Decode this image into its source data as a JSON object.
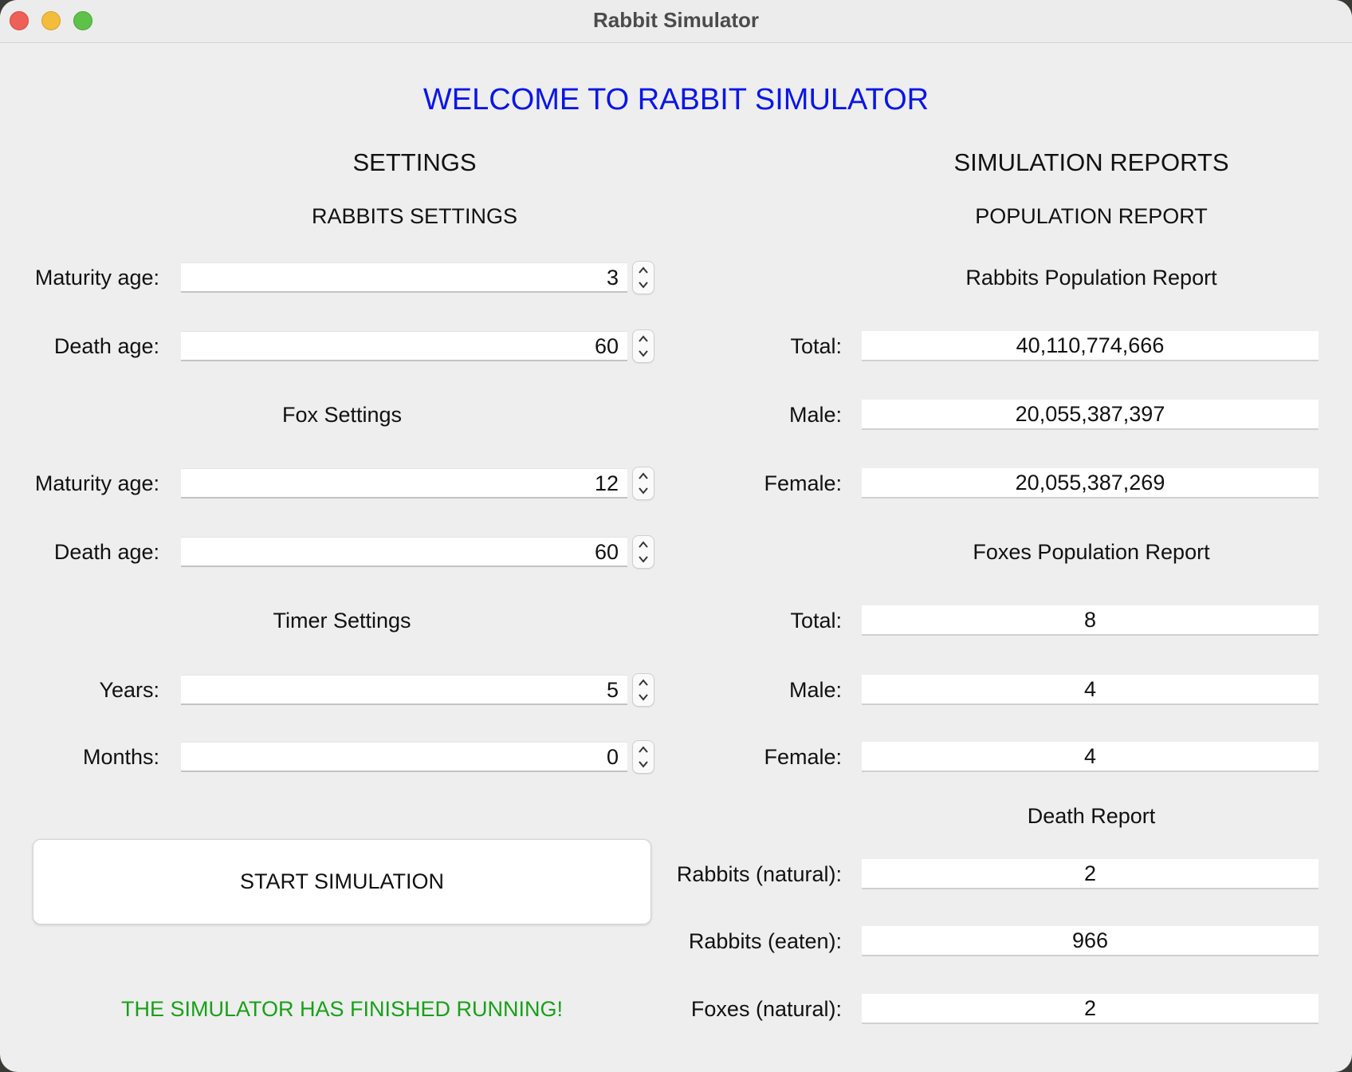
{
  "window": {
    "title": "Rabbit Simulator"
  },
  "welcome": "WELCOME TO RABBIT SIMULATOR",
  "colors": {
    "welcome": "#0a16e6",
    "status": "#18a018"
  },
  "settings": {
    "title": "SETTINGS",
    "rabbits": {
      "title": "RABBITS SETTINGS",
      "maturity_label": "Maturity age:",
      "maturity_value": "3",
      "death_label": "Death age:",
      "death_value": "60"
    },
    "fox": {
      "title": "Fox Settings",
      "maturity_label": "Maturity age:",
      "maturity_value": "12",
      "death_label": "Death age:",
      "death_value": "60"
    },
    "timer": {
      "title": "Timer Settings",
      "years_label": "Years:",
      "years_value": "5",
      "months_label": "Months:",
      "months_value": "0"
    },
    "start_button": "START SIMULATION",
    "status": "THE SIMULATOR HAS FINISHED RUNNING!"
  },
  "reports": {
    "title": "SIMULATION REPORTS",
    "population_title": "POPULATION REPORT",
    "rabbits": {
      "title": "Rabbits Population Report",
      "total_label": "Total:",
      "total_value": "40,110,774,666",
      "male_label": "Male:",
      "male_value": "20,055,387,397",
      "female_label": "Female:",
      "female_value": "20,055,387,269"
    },
    "foxes": {
      "title": "Foxes Population Report",
      "total_label": "Total:",
      "total_value": "8",
      "male_label": "Male:",
      "male_value": "4",
      "female_label": "Female:",
      "female_value": "4"
    },
    "death": {
      "title": "Death Report",
      "rabbits_natural_label": "Rabbits (natural):",
      "rabbits_natural_value": "2",
      "rabbits_eaten_label": "Rabbits (eaten):",
      "rabbits_eaten_value": "966",
      "foxes_natural_label": "Foxes (natural):",
      "foxes_natural_value": "2"
    }
  }
}
